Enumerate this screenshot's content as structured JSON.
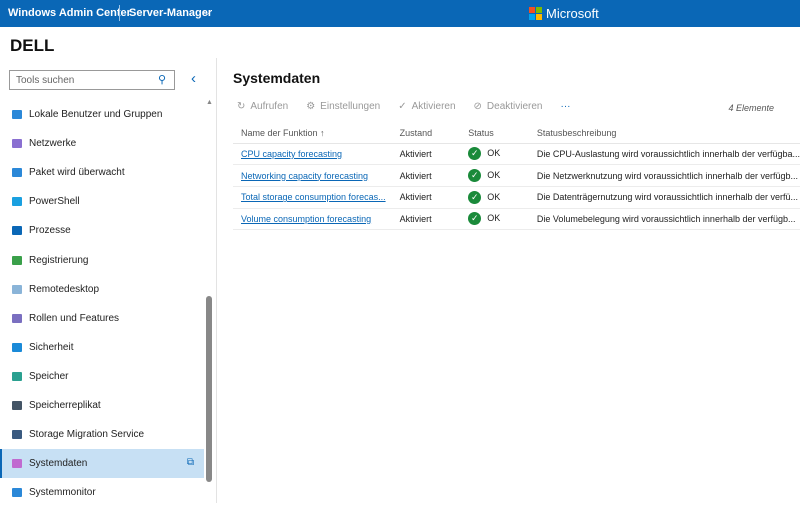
{
  "header": {
    "app_title": "Windows Admin Center",
    "server": "Server-Manager",
    "brand": "Microsoft",
    "logo_colors": [
      "#f25022",
      "#7fba00",
      "#00a4ef",
      "#ffb900"
    ]
  },
  "sidebar": {
    "brand": "DELL",
    "search_placeholder": "Tools suchen",
    "items": [
      {
        "label": "Lokale Benutzer und Gruppen",
        "icon": "users-icon",
        "color": "#2b88d8"
      },
      {
        "label": "Netzwerke",
        "icon": "network-icon",
        "color": "#8a6fd1"
      },
      {
        "label": "Paket wird überwacht",
        "icon": "packet-icon",
        "color": "#2b88d8"
      },
      {
        "label": "PowerShell",
        "icon": "powershell-icon",
        "color": "#1aa0e0"
      },
      {
        "label": "Prozesse",
        "icon": "processes-icon",
        "color": "#0a67b6"
      },
      {
        "label": "Registrierung",
        "icon": "registry-icon",
        "color": "#3aa04a"
      },
      {
        "label": "Remotedesktop",
        "icon": "remote-desktop-icon",
        "color": "#8ab4d8"
      },
      {
        "label": "Rollen und Features",
        "icon": "roles-icon",
        "color": "#7a6fc0"
      },
      {
        "label": "Sicherheit",
        "icon": "shield-icon",
        "color": "#1a8ad8"
      },
      {
        "label": "Speicher",
        "icon": "storage-icon",
        "color": "#2aa090"
      },
      {
        "label": "Speicherreplikat",
        "icon": "storage-replica-icon",
        "color": "#445566"
      },
      {
        "label": "Storage Migration Service",
        "icon": "migration-icon",
        "color": "#3a5a80"
      },
      {
        "label": "Systemdaten",
        "icon": "system-insights-icon",
        "color": "#c06ad0",
        "selected": true
      },
      {
        "label": "Systemmonitor",
        "icon": "performance-monitor-icon",
        "color": "#2b88d8"
      }
    ]
  },
  "main": {
    "title": "Systemdaten",
    "toolbar": [
      {
        "label": "Aufrufen",
        "icon": "refresh-icon"
      },
      {
        "label": "Einstellungen",
        "icon": "gear-icon"
      },
      {
        "label": "Aktivieren",
        "icon": "check-circle-icon"
      },
      {
        "label": "Deaktivieren",
        "icon": "block-icon"
      }
    ],
    "more": "···",
    "count": "4 Elemente",
    "columns": [
      "Name der Funktion ↑",
      "Zustand",
      "Status",
      "Statusbeschreibung"
    ],
    "rows": [
      {
        "name": "CPU capacity forecasting",
        "state": "Aktiviert",
        "status": "OK",
        "desc": "Die CPU-Auslastung wird voraussichtlich innerhalb der verfügba..."
      },
      {
        "name": "Networking capacity forecasting",
        "state": "Aktiviert",
        "status": "OK",
        "desc": "Die Netzwerknutzung wird voraussichtlich innerhalb der verfügb..."
      },
      {
        "name": "Total storage consumption forecas...",
        "state": "Aktiviert",
        "status": "OK",
        "desc": "Die Datenträgernutzung wird voraussichtlich innerhalb der verfü..."
      },
      {
        "name": "Volume consumption forecasting",
        "state": "Aktiviert",
        "status": "OK",
        "desc": "Die Volumebelegung wird voraussichtlich innerhalb der verfügb..."
      }
    ]
  }
}
